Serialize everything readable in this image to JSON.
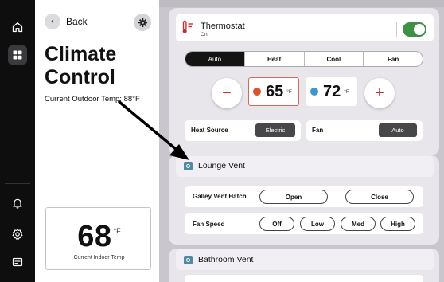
{
  "nav": {
    "items": [
      {
        "name": "home-icon"
      },
      {
        "name": "grid-icon",
        "active": true
      },
      {
        "name": "bell-icon"
      },
      {
        "name": "gear-icon"
      },
      {
        "name": "card-icon"
      }
    ]
  },
  "climate": {
    "back_label": "Back",
    "title": "Climate Control",
    "outdoor_temp": "Current Outdoor Temp: 88°F",
    "indoor_temp": "68",
    "indoor_unit": "°F",
    "indoor_label": "Current Indoor Temp"
  },
  "thermostat": {
    "title": "Thermostat",
    "status": "On",
    "toggle_on": true,
    "modes": [
      "Auto",
      "Heat",
      "Cool",
      "Fan"
    ],
    "active_mode": "Auto",
    "decrease_label": "−",
    "increase_label": "+",
    "heat_setpoint": "65",
    "cool_setpoint": "72",
    "unit": "°F",
    "heat_source_label": "Heat Source",
    "heat_source_value": "Electric",
    "fan_label": "Fan",
    "fan_value": "Auto"
  },
  "lounge_vent": {
    "title": "Lounge Vent",
    "hatch_label": "Galley Vent Hatch",
    "hatch_open": "Open",
    "hatch_close": "Close",
    "fan_speed_label": "Fan Speed",
    "speeds": [
      "Off",
      "Low",
      "Med",
      "High"
    ]
  },
  "bathroom_vent": {
    "title": "Bathroom Vent"
  },
  "colors": {
    "accent_green": "#3f8f45",
    "heat_orange": "#d8542e",
    "cool_blue": "#3d97c9",
    "step_red": "#c83030",
    "vent_teal": "#4f8aa0"
  }
}
